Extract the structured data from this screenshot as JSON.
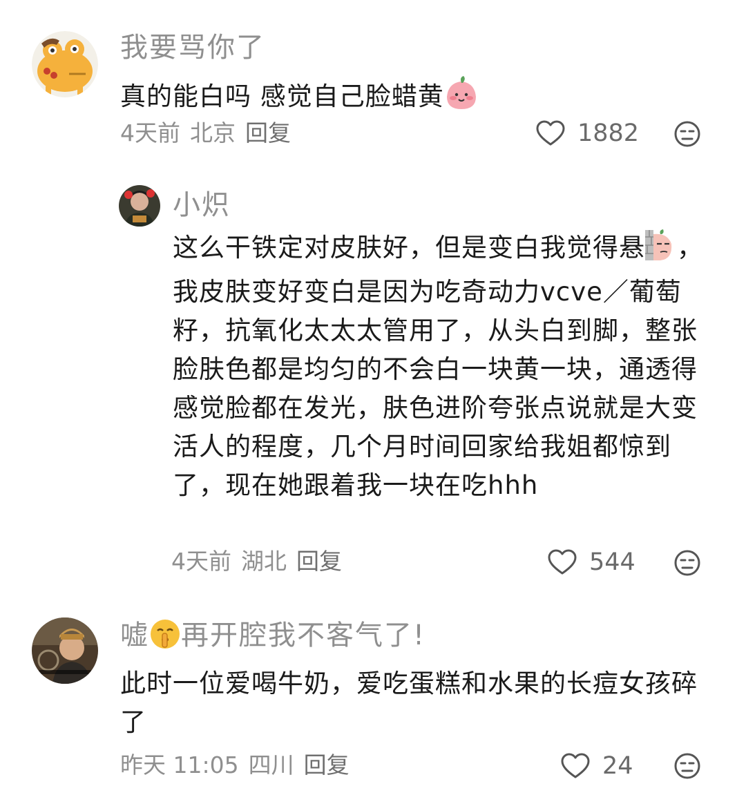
{
  "comments": [
    {
      "username": "我要骂你了",
      "text": "真的能白吗 感觉自己脸蜡黄",
      "time": "4天前",
      "location": "北京",
      "reply": "回复",
      "likes": "1882",
      "icons": {
        "avatar": "cartoon-frog-avatar",
        "sticker": "peach-face-sticker",
        "like": "heart-icon",
        "dislike": "meh-face-icon"
      }
    },
    {
      "username": "小炽",
      "text_parts": [
        "这么干铁定对皮肤好，但是变白我觉得悬",
        "，我皮肤变好变白是因为吃奇动力vcve／葡萄籽，抗氧化太太太管用了，从头白到脚，整张脸肤色都是均匀的不会白一块黄一块，通透得感觉脸都在发光，肤色进阶夸张点说就是大变活人的程度，几个月时间回家给我姐都惊到了，现在她跟着我一块在吃hhh"
      ],
      "time": "4天前",
      "location": "湖北",
      "reply": "回复",
      "likes": "544",
      "icons": {
        "avatar": "person-photo-avatar",
        "sticker": "peeking-wall-sticker",
        "like": "heart-icon",
        "dislike": "meh-face-icon"
      }
    },
    {
      "username_parts": [
        "嘘",
        "再开腔我不客气了!"
      ],
      "text": "此时一位爱喝牛奶，爱吃蛋糕和水果的长痘女孩碎了",
      "time": "昨天 11:05",
      "location": "四川",
      "reply": "回复",
      "likes": "24",
      "icons": {
        "avatar": "tv-drama-still-avatar",
        "sticker": "shush-emoji",
        "like": "heart-icon",
        "dislike": "meh-face-icon"
      }
    }
  ],
  "colors": {
    "text": "#1a1a1a",
    "meta": "#8f8f8f",
    "background": "#ffffff"
  }
}
